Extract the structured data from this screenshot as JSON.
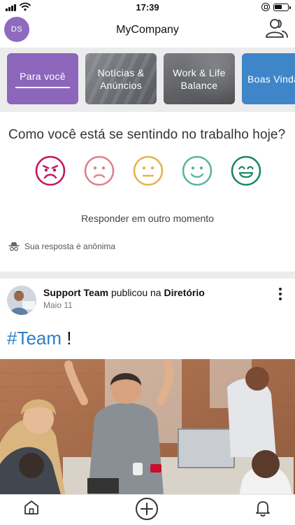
{
  "status_bar": {
    "time": "17:39"
  },
  "header": {
    "avatar_initials": "DS",
    "title": "MyCompany",
    "people_icon": "people-icon"
  },
  "categories": [
    {
      "label": "Para você",
      "color": "#8c66bb",
      "selected": true
    },
    {
      "label": "Notícias & Anúncios",
      "color": "#6d7075",
      "selected": false
    },
    {
      "label": "Work & Life Balance",
      "color": "#5e6064",
      "selected": false
    },
    {
      "label": "Boas Vindas Corporativ",
      "color": "#3f86c9",
      "selected": false
    }
  ],
  "mood": {
    "question": "Como você está se sentindo no trabalho hoje?",
    "faces": [
      {
        "name": "angry",
        "color": "#c2185b"
      },
      {
        "name": "sad",
        "color": "#e0808e"
      },
      {
        "name": "neutral",
        "color": "#e4b449"
      },
      {
        "name": "happy",
        "color": "#5bb5a2"
      },
      {
        "name": "very-happy",
        "color": "#1a8a63"
      }
    ],
    "respond_later": "Responder em outro momento",
    "anonymous_note": "Sua resposta é anônima"
  },
  "post": {
    "author": "Support Team",
    "action": " publicou na ",
    "channel": "Diretório",
    "date": "Maio 11",
    "hashtag": "#Team",
    "text_suffix": " !"
  },
  "tabbar": {
    "items": [
      "home-icon",
      "add-icon",
      "bell-icon"
    ]
  }
}
